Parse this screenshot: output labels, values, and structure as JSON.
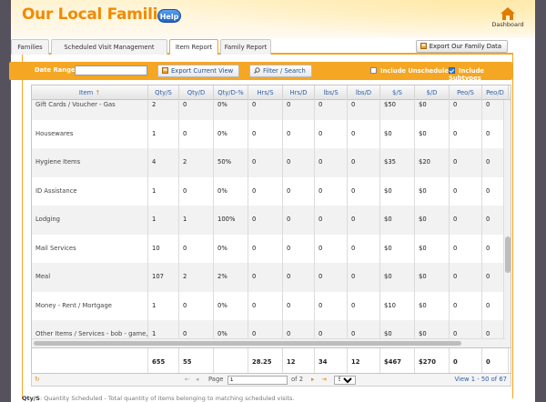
{
  "app": {
    "title": "Our Local Families",
    "help_label": "Help",
    "dashboard_label": "Dashboard"
  },
  "tabs": [
    {
      "label": "Families",
      "active": false
    },
    {
      "label": "Scheduled Visit Management",
      "active": false
    },
    {
      "label": "Item Report",
      "active": true
    },
    {
      "label": "Family Report",
      "active": false
    }
  ],
  "export_family_label": "Export Our Family Data",
  "toolbar": {
    "date_range_label": "Date Range:",
    "date_range_value": "",
    "export_view_label": "Export Current View",
    "filter_label": "Filter / Search",
    "include_unscheduled_label": "Include Unscheduled",
    "include_unscheduled_checked": false,
    "include_subtypes_label": "Include Subtypes",
    "include_subtypes_checked": true
  },
  "columns": [
    "Item",
    "Qty/S",
    "Qty/D",
    "Qty/D-%",
    "Hrs/S",
    "Hrs/D",
    "lbs/S",
    "lbs/D",
    "$/S",
    "$/D",
    "Peo/S",
    "Peo/D"
  ],
  "rows": [
    [
      "Gift Cards / Voucher - Gas",
      "2",
      "0",
      "0%",
      "0",
      "0",
      "0",
      "0",
      "$50",
      "$0",
      "0",
      "0"
    ],
    [
      "Housewares",
      "1",
      "0",
      "0%",
      "0",
      "0",
      "0",
      "0",
      "$0",
      "$0",
      "0",
      "0"
    ],
    [
      "Hygiene Items",
      "4",
      "2",
      "50%",
      "0",
      "0",
      "0",
      "0",
      "$35",
      "$20",
      "0",
      "0"
    ],
    [
      "ID Assistance",
      "1",
      "0",
      "0%",
      "0",
      "0",
      "0",
      "0",
      "$0",
      "$0",
      "0",
      "0"
    ],
    [
      "Lodging",
      "1",
      "1",
      "100%",
      "0",
      "0",
      "0",
      "0",
      "$0",
      "$0",
      "0",
      "0"
    ],
    [
      "Mail Services",
      "10",
      "0",
      "0%",
      "0",
      "0",
      "0",
      "0",
      "$0",
      "$0",
      "0",
      "0"
    ],
    [
      "Meal",
      "107",
      "2",
      "2%",
      "0",
      "0",
      "0",
      "0",
      "$0",
      "$0",
      "0",
      "0"
    ],
    [
      "Money - Rent / Mortgage",
      "1",
      "0",
      "0%",
      "0",
      "0",
      "0",
      "0",
      "$10",
      "$0",
      "0",
      "0"
    ],
    [
      "Other Items / Services - bob - game, ball",
      "1",
      "0",
      "0%",
      "0",
      "0",
      "0",
      "0",
      "$0",
      "$0",
      "0",
      "0"
    ]
  ],
  "totals": [
    "",
    "655",
    "55",
    "",
    "28.25",
    "12",
    "34",
    "12",
    "$467",
    "$270",
    "0",
    "0"
  ],
  "pager": {
    "page_label": "Page",
    "page_value": "1",
    "of_label": "of 2",
    "page_size": "50",
    "view_info": "View 1 - 50 of 67"
  },
  "caption": {
    "term": "Qty/S",
    "text": ": Quantity Scheduled - Total quantity of items belonging to matching scheduled visits."
  }
}
